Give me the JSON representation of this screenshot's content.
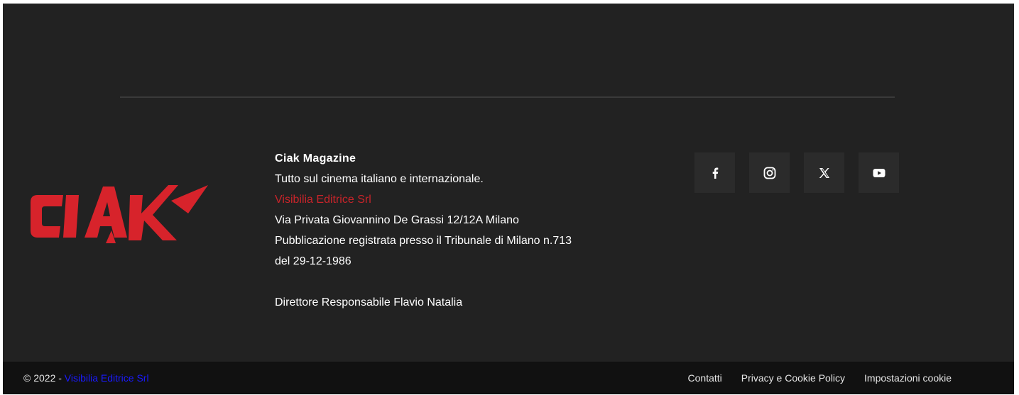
{
  "brand": {
    "logo_text": "CIAK",
    "accent": "#d7232b"
  },
  "info": {
    "name": "Ciak Magazine",
    "tagline": "Tutto sul cinema italiano e internazionale.",
    "publisher": "Visibilia Editrice Srl",
    "address": "Via Privata Giovannino De Grassi 12/12A Milano",
    "registration_line1": "Pubblicazione registrata presso il Tribunale di Milano n.713",
    "registration_line2": "del 29-12-1986",
    "director": "Direttore Responsabile Flavio Natalia"
  },
  "social": [
    {
      "icon": "facebook-icon"
    },
    {
      "icon": "instagram-icon"
    },
    {
      "icon": "x-icon"
    },
    {
      "icon": "youtube-icon"
    }
  ],
  "bottom": {
    "copyright_prefix": "© 2022 - ",
    "copyright_link": "Visibilia Editrice Srl",
    "links": [
      "Contatti",
      "Privacy e Cookie Policy",
      "Impostazioni cookie"
    ]
  },
  "colors": {
    "footer_bg": "#222222",
    "bottom_bg": "#111111",
    "publisher_link": "#c8242a",
    "copyright_link": "#1a1aff"
  }
}
